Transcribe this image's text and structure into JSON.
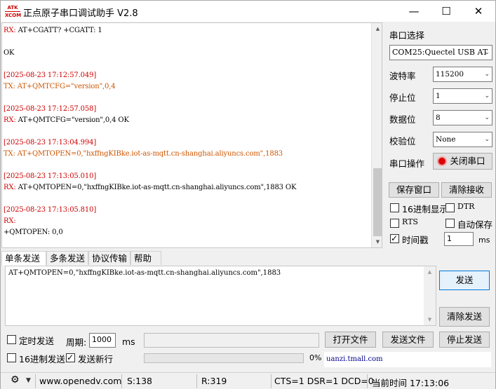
{
  "titlebar": {
    "logo_top": "ATK",
    "logo_bottom": "XCOM",
    "title": "正点原子串口调试助手 V2.8",
    "minimize": "—",
    "maximize": "☐",
    "close": "✕"
  },
  "receive": {
    "lines": [
      {
        "text": "RX: AT+CGATT? +CGATT: 1",
        "color": "mixed-rx"
      },
      {
        "text": "",
        "color": "blk"
      },
      {
        "text": "OK",
        "color": "blk"
      },
      {
        "text": "",
        "color": "blk"
      },
      {
        "text": "[2025-08-23 17:12:57.049]",
        "color": "red"
      },
      {
        "text": "TX: AT+QMTCFG=\"version\",0,4",
        "color": "tx"
      },
      {
        "text": "",
        "color": "blk"
      },
      {
        "text": "[2025-08-23 17:12:57.058]",
        "color": "red"
      },
      {
        "text": "RX: AT+QMTCFG=\"version\",0,4 OK",
        "color": "mixed-rx"
      },
      {
        "text": "",
        "color": "blk"
      },
      {
        "text": "[2025-08-23 17:13:04.994]",
        "color": "red"
      },
      {
        "text": "TX: AT+QMTOPEN=0,\"hxffngKIBke.iot-as-mqtt.cn-shanghai.aliyuncs.com\",1883",
        "color": "tx"
      },
      {
        "text": "",
        "color": "blk"
      },
      {
        "text": "[2025-08-23 17:13:05.010]",
        "color": "red"
      },
      {
        "text": "RX: AT+QMTOPEN=0,\"hxffngKIBke.iot-as-mqtt.cn-shanghai.aliyuncs.com\",1883 OK",
        "color": "mixed-rx"
      },
      {
        "text": "",
        "color": "blk"
      },
      {
        "text": "[2025-08-23 17:13:05.810]",
        "color": "red"
      },
      {
        "text": "RX:",
        "color": "red"
      },
      {
        "text": "+QMTOPEN: 0,0",
        "color": "blk"
      }
    ],
    "scroll_up": "▲",
    "scroll_down": "▼"
  },
  "right_panel": {
    "port_select_label": "串口选择",
    "port_value": "COM25:Quectel USB AT",
    "baud_label": "波特率",
    "baud_value": "115200",
    "stopbits_label": "停止位",
    "stopbits_value": "1",
    "databits_label": "数据位",
    "databits_value": "8",
    "parity_label": "校验位",
    "parity_value": "None",
    "port_op_label": "串口操作",
    "close_port_btn": "关闭串口",
    "save_window_btn": "保存窗口",
    "clear_recv_btn": "清除接收",
    "hex_display": "16进制显示",
    "dtr": "DTR",
    "rts": "RTS",
    "auto_save": "自动保存",
    "timestamp": "时间戳",
    "timestamp_ms_value": "1",
    "ms": "ms"
  },
  "tabs": [
    "单条发送",
    "多条发送",
    "协议传输",
    "帮助"
  ],
  "send": {
    "text": "AT+QMTOPEN=0,\"hxffngKIBke.iot-as-mqtt.cn-shanghai.aliyuncs.com\",1883",
    "send_btn": "发送",
    "clear_send_btn": "清除发送",
    "timed_send": "定时发送",
    "period_label": "周期:",
    "period_value": "1000",
    "ms": "ms",
    "open_file_btn": "打开文件",
    "send_file_btn": "发送文件",
    "stop_send_btn": "停止发送",
    "hex_send": "16进制发送",
    "send_newline": "发送新行",
    "progress_pct": "0%",
    "progress_value": 0,
    "ad_text": "uanzi.tmall.com"
  },
  "status": {
    "gear": "⚙",
    "website": "www.openedv.com",
    "s_count": "S:138",
    "r_count": "R:319",
    "lines": "CTS=1 DSR=1 DCD=0",
    "time": "当前时间 17:13:06"
  }
}
